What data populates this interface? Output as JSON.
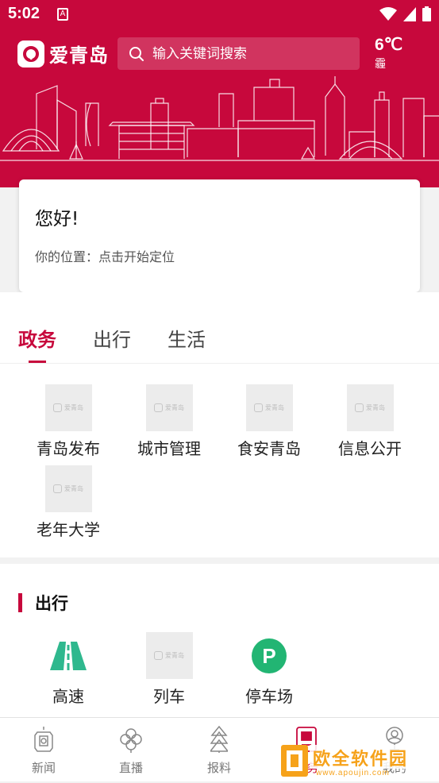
{
  "status_bar": {
    "time": "5:02",
    "notification_icon": "A"
  },
  "header": {
    "logo_text": "爱青岛",
    "search_placeholder": "输入关键词搜索",
    "weather": {
      "temperature": "6℃",
      "condition": "霾"
    }
  },
  "greeting_card": {
    "title": "您好!",
    "location_text": "你的位置：点击开始定位"
  },
  "tabs": [
    {
      "label": "政务",
      "active": true
    },
    {
      "label": "出行",
      "active": false
    },
    {
      "label": "生活",
      "active": false
    }
  ],
  "placeholder_logo_text": "爱青岛",
  "gov_items": [
    {
      "label": "青岛发布"
    },
    {
      "label": "城市管理"
    },
    {
      "label": "食安青岛"
    },
    {
      "label": "信息公开"
    },
    {
      "label": "老年大学"
    }
  ],
  "travel_section": {
    "title": "出行",
    "items": [
      {
        "label": "高速",
        "icon": "highway-icon"
      },
      {
        "label": "列车",
        "icon": "placeholder"
      },
      {
        "label": "停车场",
        "icon": "parking-icon",
        "glyph": "P"
      }
    ]
  },
  "bottom_nav": [
    {
      "label": "新闻",
      "icon": "news-icon"
    },
    {
      "label": "直播",
      "icon": "live-icon"
    },
    {
      "label": "报料",
      "icon": "report-icon"
    },
    {
      "label": "服务",
      "icon": "service-icon",
      "active": true
    },
    {
      "label": "我的",
      "icon": "profile-icon"
    }
  ],
  "watermark": {
    "title": "欧全软件园",
    "url": "www.apoujin.com"
  },
  "colors": {
    "brand": "#c7083c",
    "highway": "#2fb88e",
    "parking": "#22b573"
  }
}
